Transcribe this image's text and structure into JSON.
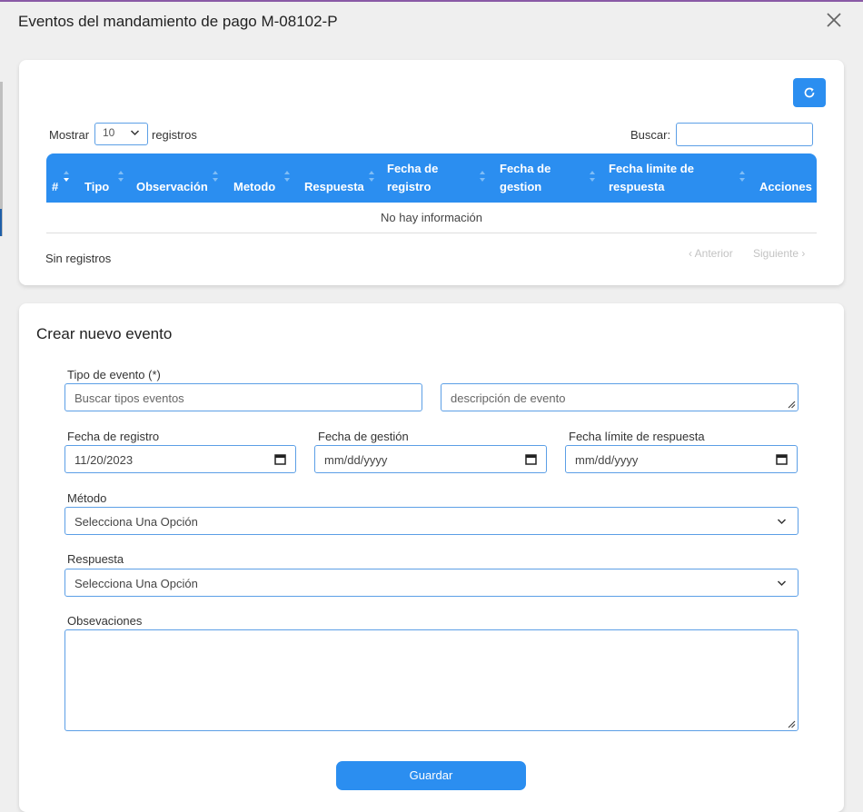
{
  "modal": {
    "title": "Eventos del mandamiento de pago M-08102-P"
  },
  "table": {
    "length_label_before": "Mostrar",
    "length_value": "10",
    "length_label_after": "registros",
    "search_label": "Buscar:",
    "columns": [
      "#",
      "Tipo",
      "Observación",
      "Metodo",
      "Respuesta",
      "Fecha de registro",
      "Fecha de gestion",
      "Fecha limite de respuesta",
      "Acciones"
    ],
    "empty_message": "No hay información",
    "info": "Sin registros",
    "prev_label": "Anterior",
    "next_label": "Siguiente"
  },
  "form": {
    "title": "Crear nuevo evento",
    "tipo_label": "Tipo de evento (*)",
    "tipo_placeholder": "Buscar tipos eventos",
    "descripcion_placeholder": "descripción de evento",
    "fecha_registro_label": "Fecha de registro",
    "fecha_registro_value": "11/20/2023",
    "fecha_gestion_label": "Fecha de gestión",
    "fecha_gestion_value": "mm/dd/yyyy",
    "fecha_limite_label": "Fecha límite de respuesta",
    "fecha_limite_value": "mm/dd/yyyy",
    "metodo_label": "Método",
    "metodo_value": "Selecciona Una Opción",
    "respuesta_label": "Respuesta",
    "respuesta_value": "Selecciona Una Opción",
    "observaciones_label": "Obsevaciones",
    "save_label": "Guardar"
  },
  "colors": {
    "accent": "#2b8ef0",
    "field_border": "#5c9fe6"
  },
  "icons": [
    "close-icon",
    "refresh-icon",
    "chevron-down-icon",
    "sort-icon",
    "calendar-icon",
    "resize-handle-icon"
  ]
}
